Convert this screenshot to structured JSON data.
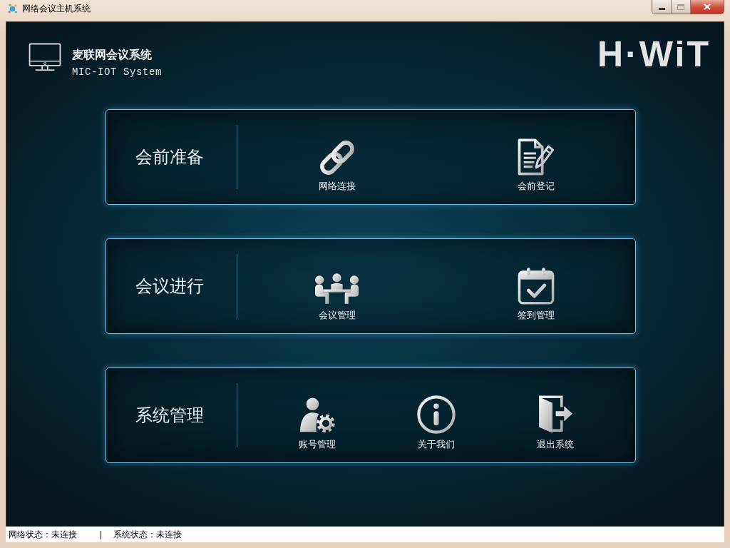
{
  "window": {
    "title": "网络会议主机系统"
  },
  "header": {
    "title": "麦联网会议系统",
    "subtitle": "MIC-IOT System",
    "logo": "H·WiT"
  },
  "sections": [
    {
      "title": "会前准备",
      "items": [
        {
          "kind": "link",
          "label": "网络连接"
        },
        {
          "kind": "document",
          "label": "会前登记"
        }
      ]
    },
    {
      "title": "会议进行",
      "items": [
        {
          "kind": "meeting",
          "label": "会议管理"
        },
        {
          "kind": "calendar",
          "label": "签到管理"
        }
      ]
    },
    {
      "title": "系统管理",
      "items": [
        {
          "kind": "account",
          "label": "账号管理"
        },
        {
          "kind": "info",
          "label": "关于我们"
        },
        {
          "kind": "exit",
          "label": "退出系统"
        }
      ]
    }
  ],
  "status_bar": {
    "items": [
      "网络状态：未连接",
      "系统状态：未连接"
    ],
    "separator": "|"
  }
}
